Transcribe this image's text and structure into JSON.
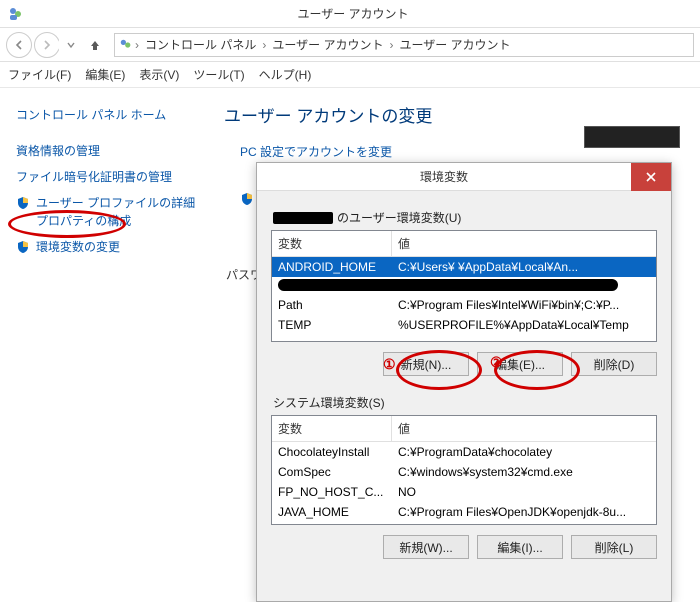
{
  "window": {
    "title": "ユーザー アカウント"
  },
  "breadcrumb": {
    "items": [
      "コントロール パネル",
      "ユーザー アカウント",
      "ユーザー アカウント"
    ]
  },
  "menu": {
    "file": "ファイル(F)",
    "edit": "編集(E)",
    "view": "表示(V)",
    "tools": "ツール(T)",
    "help": "ヘルプ(H)"
  },
  "side": {
    "home": "コントロール パネル ホーム",
    "cred": "資格情報の管理",
    "enc": "ファイル暗号化証明書の管理",
    "profiles": "ユーザー プロファイルの詳細プロパティの構成",
    "envvars": "環境変数の変更"
  },
  "content": {
    "heading": "ユーザー アカウントの変更",
    "pc_settings": "PC 設定でアカウントを変更",
    "password_label": "パスワ"
  },
  "dialog": {
    "title": "環境変数",
    "user_vars_label_suffix": "のユーザー環境変数(U)",
    "col_var": "変数",
    "col_val": "値",
    "user_vars": [
      {
        "name": "ANDROID_HOME",
        "value": "C:¥Users¥          ¥AppData¥Local¥An...",
        "selected": true
      },
      {
        "redacted": true
      },
      {
        "name": "Path",
        "value": "C:¥Program Files¥Intel¥WiFi¥bin¥;C:¥P..."
      },
      {
        "name": "TEMP",
        "value": "%USERPROFILE%¥AppData¥Local¥Temp"
      }
    ],
    "user_buttons": {
      "new": "新規(N)...",
      "edit": "編集(E)...",
      "delete": "削除(D)"
    },
    "sys_vars_label": "システム環境変数(S)",
    "sys_vars": [
      {
        "name": "ChocolateyInstall",
        "value": "C:¥ProgramData¥chocolatey"
      },
      {
        "name": "ComSpec",
        "value": "C:¥windows¥system32¥cmd.exe"
      },
      {
        "name": "FP_NO_HOST_C...",
        "value": "NO"
      },
      {
        "name": "JAVA_HOME",
        "value": "C:¥Program Files¥OpenJDK¥openjdk-8u..."
      }
    ],
    "sys_buttons": {
      "new": "新規(W)...",
      "edit": "編集(I)...",
      "delete": "削除(L)"
    }
  },
  "annotations": {
    "one": "①",
    "two": "②"
  }
}
